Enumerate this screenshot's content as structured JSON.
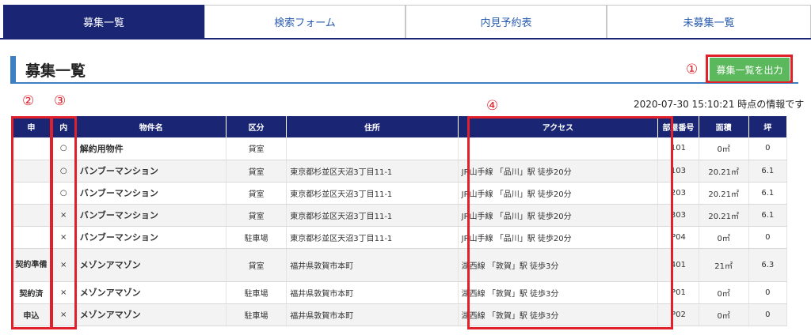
{
  "tabs": [
    {
      "label": "募集一覧",
      "active": true
    },
    {
      "label": "検索フォーム",
      "active": false
    },
    {
      "label": "内見予約表",
      "active": false
    },
    {
      "label": "未募集一覧",
      "active": false
    }
  ],
  "section": {
    "title": "募集一覧",
    "export_label": "募集一覧を出力"
  },
  "timestamp": "2020-07-30 15:10:21 時点の情報です",
  "annotations": {
    "n1": "①",
    "n2": "②",
    "n3": "③",
    "n4": "④"
  },
  "table": {
    "headers": [
      "申",
      "内",
      "物件名",
      "区分",
      "住所",
      "アクセス",
      "部屋番号",
      "面積",
      "坪"
    ],
    "rows": [
      {
        "app": "",
        "viewing": "○",
        "name": "解約用物件",
        "kind": "貸室",
        "address": "",
        "access": "",
        "room": "101",
        "area": "0㎡",
        "tsubo": "0"
      },
      {
        "app": "",
        "viewing": "○",
        "name": "バンブーマンション",
        "kind": "貸室",
        "address": "東京都杉並区天沼3丁目11-1",
        "access": "JR山手線 「品川」駅 徒歩20分",
        "room": "103",
        "area": "20.21㎡",
        "tsubo": "6.1"
      },
      {
        "app": "",
        "viewing": "○",
        "name": "バンブーマンション",
        "kind": "貸室",
        "address": "東京都杉並区天沼3丁目11-1",
        "access": "JR山手線 「品川」駅 徒歩20分",
        "room": "203",
        "area": "20.21㎡",
        "tsubo": "6.1"
      },
      {
        "app": "",
        "viewing": "×",
        "name": "バンブーマンション",
        "kind": "貸室",
        "address": "東京都杉並区天沼3丁目11-1",
        "access": "JR山手線 「品川」駅 徒歩20分",
        "room": "303",
        "area": "20.21㎡",
        "tsubo": "6.1"
      },
      {
        "app": "",
        "viewing": "×",
        "name": "バンブーマンション",
        "kind": "駐車場",
        "address": "東京都杉並区天沼3丁目11-1",
        "access": "JR山手線 「品川」駅 徒歩20分",
        "room": "P04",
        "area": "0㎡",
        "tsubo": "0"
      },
      {
        "app": "契約準備",
        "viewing": "×",
        "name": "メゾンアマゾン",
        "kind": "貸室",
        "address": "福井県敦賀市本町",
        "access": "湖西線 「敦賀」駅 徒歩3分",
        "room": "401",
        "area": "21㎡",
        "tsubo": "6.3"
      },
      {
        "app": "契約済",
        "viewing": "×",
        "name": "メゾンアマゾン",
        "kind": "駐車場",
        "address": "福井県敦賀市本町",
        "access": "湖西線 「敦賀」駅 徒歩3分",
        "room": "P01",
        "area": "0㎡",
        "tsubo": "0"
      },
      {
        "app": "申込",
        "viewing": "×",
        "name": "メゾンアマゾン",
        "kind": "駐車場",
        "address": "福井県敦賀市本町",
        "access": "湖西線 「敦賀」駅 徒歩3分",
        "room": "P02",
        "area": "0㎡",
        "tsubo": "0"
      }
    ]
  }
}
